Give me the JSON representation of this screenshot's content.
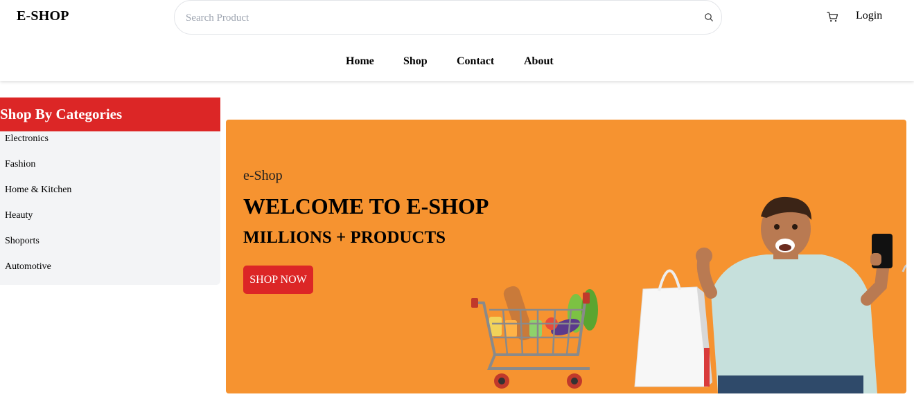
{
  "brand": {
    "logo": "E-SHOP"
  },
  "search": {
    "placeholder": "Search Product",
    "icon": "search-icon"
  },
  "header_actions": {
    "cart_icon": "cart-icon",
    "login_label": "Login"
  },
  "nav": {
    "items": [
      "Home",
      "Shop",
      "Contact",
      "About"
    ]
  },
  "sidebar": {
    "title": "Shop By Categories",
    "categories": [
      "Electronics",
      "Fashion",
      "Home & Kitchen",
      "Heauty",
      "Shoports",
      "Automotive"
    ]
  },
  "hero": {
    "eyebrow": "e-Shop",
    "title": "WELCOME TO E-SHOP",
    "subtitle": "MILLIONS + PRODUCTS",
    "cta_label": "SHOP NOW",
    "illustration": "shopping-cart-and-man-with-bags-image"
  },
  "colors": {
    "accent_red": "#dc2626",
    "hero_orange": "#f69330",
    "sidebar_bg": "#f3f4f6"
  }
}
